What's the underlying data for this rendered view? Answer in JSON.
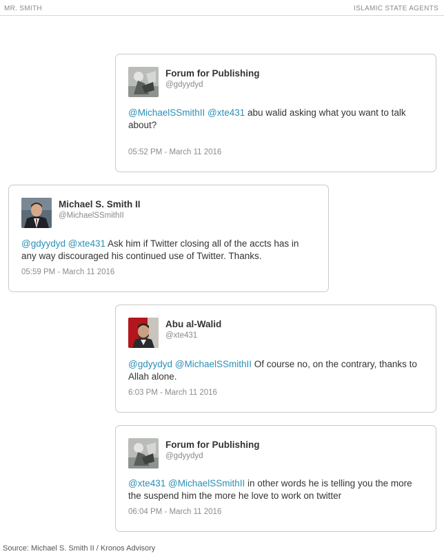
{
  "header": {
    "left": "MR. SMITH",
    "right": "ISLAMIC STATE AGENTS"
  },
  "tweets": [
    {
      "name": "Forum for Publishing",
      "handle": "@gdyydyd",
      "mentions": [
        "@MichaelSSmithII",
        "@xte431"
      ],
      "text": "abu walid asking what you want to talk about?",
      "time": "05:52 PM - March 11 2016",
      "avatar": "forum-avatar"
    },
    {
      "name": "Michael S. Smith II",
      "handle": "@MichaelSSmithII",
      "mentions": [
        "@gdyydyd",
        "@xte431"
      ],
      "text": "Ask him if Twitter closing all of the accts has in any way discouraged his continued use of Twitter. Thanks.",
      "time": "05:59 PM - March 11 2016",
      "avatar": "suited-man-avatar"
    },
    {
      "name": "Abu al-Walid",
      "handle": "@xte431",
      "mentions": [
        "@gdyydyd",
        "@MichaelSSmithII"
      ],
      "text": "Of course no, on the contrary, thanks to Allah alone.",
      "time": "6:03 PM - March 11 2016",
      "avatar": "red-background-avatar"
    },
    {
      "name": "Forum for Publishing",
      "handle": "@gdyydyd",
      "mentions": [
        "@xte431",
        "@MichaelSSmithII"
      ],
      "text": "in other words he is telling you the more the suspend him the more he love to work on twitter",
      "time": "06:04 PM - March 11 2016",
      "avatar": "forum-avatar"
    }
  ],
  "source": "Source: Michael S. Smith II / Kronos Advisory",
  "colors": {
    "mention": "#2a8fb5",
    "border": "#c9c9c9",
    "muted": "#8c8c8c"
  }
}
